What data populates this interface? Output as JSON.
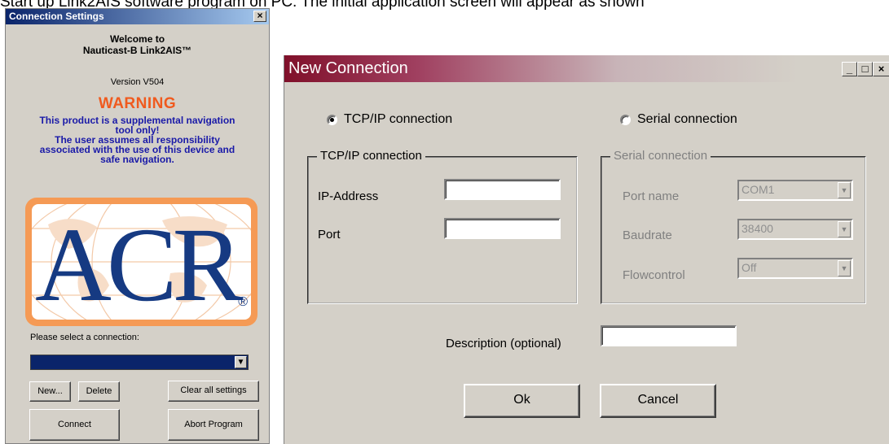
{
  "doc_caption": "Start up Link2AIS software program on PC. The initial application screen will appear as shown",
  "connection_settings": {
    "title": "Connection Settings",
    "close_glyph": "×",
    "welcome_line1": "Welcome to",
    "welcome_line2": "Nauticast-B Link2AIS™",
    "version": "Version V504",
    "warning_title": "WARNING",
    "warning_lines": [
      "This product is a supplemental navigation",
      "tool only!",
      "The user assumes all responsibility",
      "associated with the use of this device and",
      "safe navigation."
    ],
    "logo_text": "ACR",
    "logo_reg": "®",
    "select_label": "Please select a connection:",
    "select_value": "",
    "buttons": {
      "new": "New...",
      "delete": "Delete",
      "clear": "Clear all settings",
      "connect": "Connect",
      "abort": "Abort Program"
    }
  },
  "new_connection": {
    "title": "New Connection",
    "radio_tcp": "TCP/IP connection",
    "radio_serial": "Serial connection",
    "tcp_group": {
      "legend": "TCP/IP connection",
      "ip_label": "IP-Address",
      "ip_value": "",
      "port_label": "Port",
      "port_value": ""
    },
    "serial_group": {
      "legend": "Serial connection",
      "port_name_label": "Port name",
      "port_name_value": "COM1",
      "baudrate_label": "Baudrate",
      "baudrate_value": "38400",
      "flowcontrol_label": "Flowcontrol",
      "flowcontrol_value": "Off"
    },
    "description_label": "Description (optional)",
    "description_value": "",
    "ok_label": "Ok",
    "cancel_label": "Cancel"
  }
}
